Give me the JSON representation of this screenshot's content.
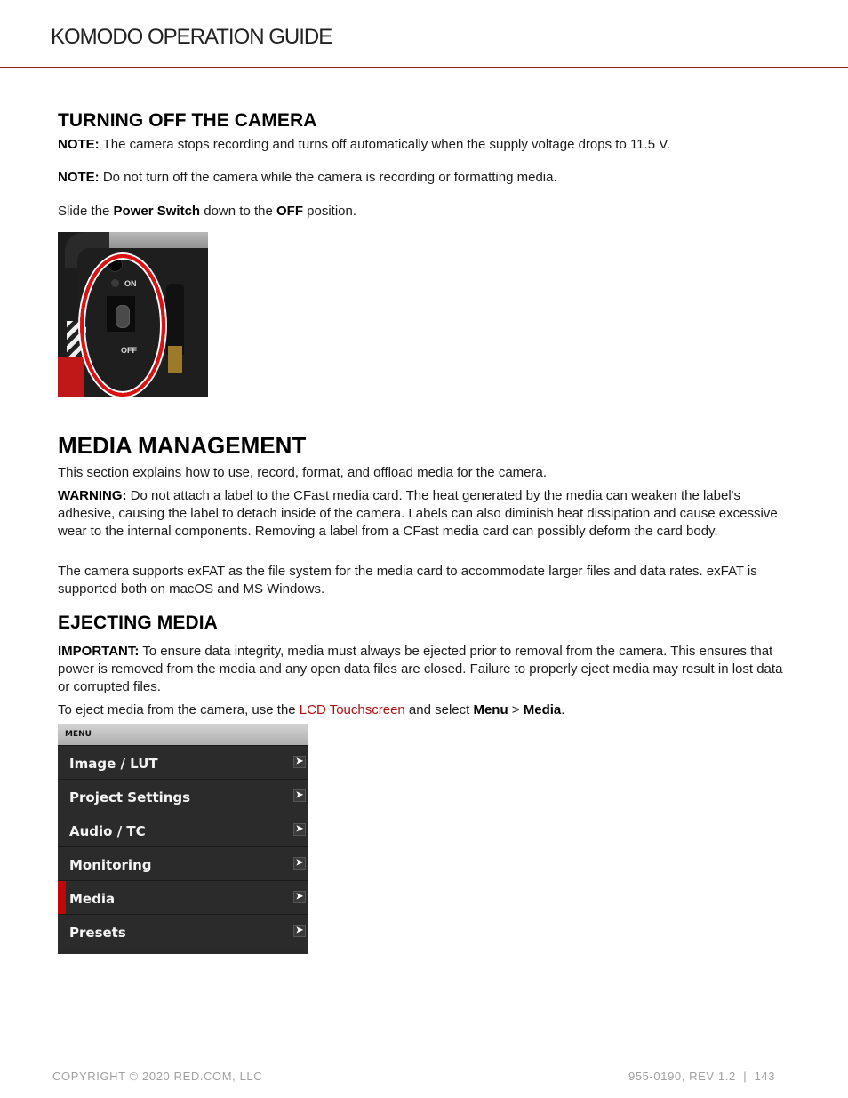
{
  "header": {
    "title": "KOMODO OPERATION GUIDE"
  },
  "turning_off": {
    "heading": "TURNING OFF THE CAMERA",
    "note1": {
      "label": "NOTE:",
      "text": " The camera stops recording and turns off automatically when the supply voltage drops to 11.5 V."
    },
    "note2": {
      "label": "NOTE:",
      "text": " Do not turn off the camera while the camera is recording or formatting media."
    },
    "instruction": {
      "pre": "Slide the ",
      "bold1": "Power Switch",
      "mid": " down to the ",
      "bold2": "OFF",
      "post": " position."
    },
    "image": {
      "label_on": "ON",
      "label_off": "OFF"
    }
  },
  "media_management": {
    "heading": "MEDIA MANAGEMENT",
    "intro": "This section explains how to use, record, format, and offload media for the camera.",
    "warning": {
      "label": "WARNING:",
      "text": " Do not attach a label to the CFast media card. The heat generated by the media can weaken the label's adhesive, causing the label to detach inside of the camera. Labels can also diminish heat dissipation and cause excessive wear to the internal components. Removing a label from a CFast media card can possibly deform the card body."
    },
    "exfat": "The camera supports exFAT as the file system for the media card to accommodate larger files and data rates. exFAT is supported both on macOS and MS Windows."
  },
  "ejecting_media": {
    "heading": "EJECTING MEDIA",
    "important": {
      "label": "IMPORTANT:",
      "text": " To ensure data integrity, media must always be ejected prior to removal from the camera. This ensures that power is removed from the media and any open data files are closed. Failure to properly eject media may result in lost data or corrupted files."
    },
    "instruction": {
      "pre": "To eject media from the camera, use the ",
      "link": "LCD Touchscreen",
      "mid": " and select ",
      "bold1": "Menu",
      "sep": " > ",
      "bold2": "Media",
      "post": "."
    }
  },
  "menu": {
    "header": "MENU",
    "items": [
      {
        "label": "Image / LUT",
        "icon": "chevron-right-icon"
      },
      {
        "label": "Project Settings",
        "icon": "chevron-right-icon"
      },
      {
        "label": "Audio / TC",
        "icon": "chevron-right-icon"
      },
      {
        "label": "Monitoring",
        "icon": "chevron-right-icon"
      },
      {
        "label": "Media",
        "icon": "chevron-right-icon",
        "selected": true
      },
      {
        "label": "Presets",
        "icon": "chevron-right-icon"
      }
    ],
    "chevron_glyph": "➤",
    "accent_color": "#c00808"
  },
  "footer": {
    "copyright": "COPYRIGHT © 2020 RED.COM, LLC",
    "docref": "955-0190, REV 1.2  |  143"
  },
  "colors": {
    "rule": "#8b1a1a",
    "link": "#b01010"
  }
}
